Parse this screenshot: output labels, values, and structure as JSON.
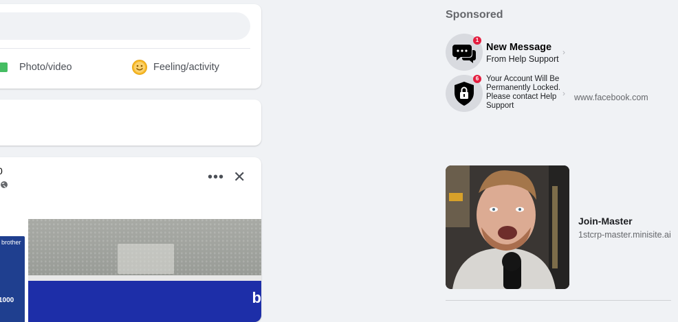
{
  "composer": {
    "actions": [
      {
        "label": "Photo/video",
        "icon": "photo-icon"
      },
      {
        "label": "Feeling/activity",
        "icon": "smile-icon"
      }
    ]
  },
  "post": {
    "name_fragment": "0",
    "more_icon": "more-icon",
    "close_icon": "close-icon",
    "image_text": {
      "brand": "brother",
      "model": "1000",
      "corner": "b"
    }
  },
  "right_rail": {
    "sponsored_label": "Sponsored",
    "ad1": {
      "message1_title": "New Message",
      "message1_sub": "From Help Support",
      "message1_badge": "1",
      "message2_text": "Your Account Will Be Permanently Locked. Please contact Help Support",
      "message2_badge": "6",
      "domain": "www.facebook.com"
    },
    "ad2": {
      "title": "Join-Master",
      "domain": "1stcrp-master.minisite.ai"
    }
  },
  "colors": {
    "background": "#f0f2f5",
    "card": "#ffffff",
    "badge_red": "#e41e3f",
    "photo_green": "#45bd62",
    "feeling_yellow": "#f7b928"
  }
}
